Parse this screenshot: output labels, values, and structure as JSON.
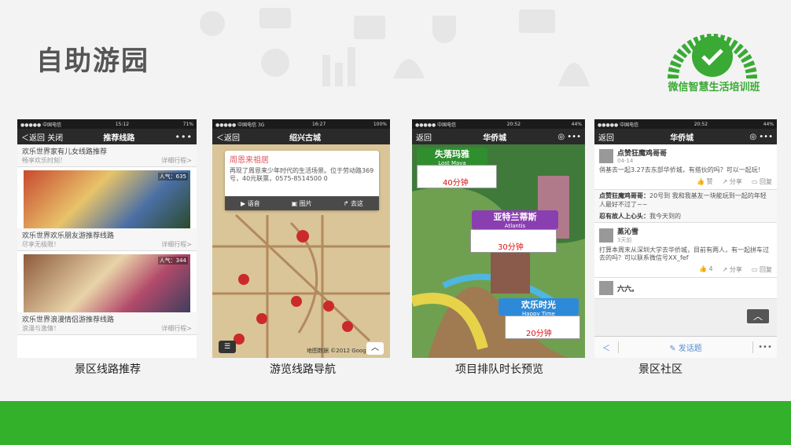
{
  "slide": {
    "title": "自助游园",
    "logo_caption": "微信智慧生活培训班",
    "captions": [
      "景区线路推荐",
      "游览线路导航",
      "项目排队时长预览",
      "景区社区"
    ]
  },
  "phone1": {
    "status": {
      "carrier": "●●●●● 中国电信 ",
      "time": "15:12",
      "battery": "71%"
    },
    "nav": {
      "back": "＜返回",
      "close": "关闭",
      "title": "推荐线路",
      "more": "•••"
    },
    "routes": [
      {
        "title": "欢乐世界家有儿女线路推荐",
        "sub": "畅享欢乐时刻！",
        "detail": "详细行程>",
        "popularity": ""
      },
      {
        "title": "欢乐世界欢乐朋友游推荐线路",
        "sub": "尽享无极限！",
        "detail": "详细行程>",
        "popularity": "人气：635"
      },
      {
        "title": "欢乐世界浪漫情侣游推荐线路",
        "sub": "浪漫与激情！",
        "detail": "详细行程>",
        "popularity": "人气：344"
      }
    ]
  },
  "phone2": {
    "status": {
      "carrier": "●●●●● 中国电信 3G",
      "time": "16:27",
      "battery": "100%"
    },
    "nav": {
      "back": "＜返回",
      "title": "绍兴古城"
    },
    "popup": {
      "title": "周恩来祖居",
      "desc": "再现了周恩来少年时代的生活场景。位于劳动路369号，40元联票，0575-8514500 0",
      "actions": [
        "语音",
        "图片",
        "去这"
      ]
    },
    "map_credit": "地图数据 ©2012 Google"
  },
  "phone3": {
    "status": {
      "carrier": "●●●●● 中国电信",
      "time": "20:52",
      "battery": "44%"
    },
    "nav": {
      "back": "返回",
      "title": "华侨城"
    },
    "zones": [
      {
        "name": "失落玛雅",
        "en": "Lost Maya",
        "wait": "40分钟"
      },
      {
        "name": "亚特兰蒂斯",
        "en": "Atlantis",
        "wait": "30分钟"
      },
      {
        "name": "欢乐时光",
        "en": "Happy Time",
        "wait": "20分钟"
      }
    ],
    "colors": {
      "maya": "#2f8f2f",
      "atlantis": "#8a3fb0",
      "happy": "#2e8ad8"
    }
  },
  "phone4": {
    "status": {
      "carrier": "●●●●● 中国电信",
      "time": "20:52",
      "battery": "44%"
    },
    "nav": {
      "back": "返回",
      "title": "华侨城"
    },
    "posts": [
      {
        "name": "点赞狂魔鸡哥哥",
        "time": "04-14",
        "text": "俏基去一起3.27去东部华侨城，有搭伙的吗？可以一起玩！",
        "like": "赞",
        "share": "分享",
        "reply": "回复"
      },
      {
        "name": "蒸沁雪",
        "time": "3天前",
        "text": "打算本周末从深圳大学去华侨城，目前有两人，有一起拼车过去的吗？可以联系微信号XX_fef",
        "like": "4",
        "share": "分享",
        "reply": "回复"
      },
      {
        "name": "六六。",
        "time": "",
        "text": "",
        "like": "",
        "share": "",
        "reply": ""
      }
    ],
    "replies": [
      {
        "name": "点赞狂魔鸡哥哥：",
        "text": "20号到 我和我基友一块能玩到一起的年轻人最好不过了~~"
      },
      {
        "name": "忍有故人上心头：",
        "text": "我今天到的"
      }
    ],
    "bottom": {
      "back": "＜",
      "post": "发话题",
      "more": "•••"
    }
  }
}
